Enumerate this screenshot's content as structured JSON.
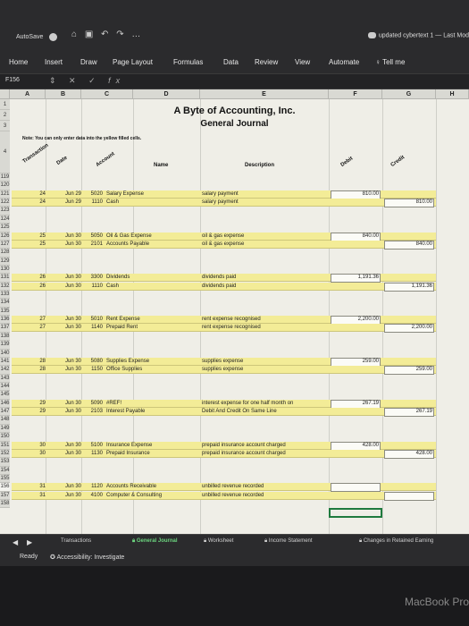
{
  "titlebar": {
    "autosave_label": "AutoSave",
    "doc_title": "updated cybertext 1 — Last Mod"
  },
  "ribbon": {
    "tabs": [
      "Home",
      "Insert",
      "Draw",
      "Page Layout",
      "Formulas",
      "Data",
      "Review",
      "View",
      "Automate"
    ],
    "tell_me": "Tell me"
  },
  "formula_bar": {
    "name_box": "F156",
    "fx": "fx"
  },
  "columns": [
    "A",
    "B",
    "C",
    "D",
    "E",
    "F",
    "G",
    "H"
  ],
  "sheet": {
    "row1": "1",
    "row2": "2",
    "row3": "3",
    "row4": "4",
    "title": "A Byte of Accounting, Inc.",
    "subtitle": "General Journal",
    "note": "Note: You can only enter data into the yellow filled cells.",
    "headers": {
      "transaction": "Transaction",
      "date": "Date",
      "account": "Account",
      "name": "Name",
      "description": "Description",
      "debit": "Debit",
      "credit": "Credit"
    },
    "rows": [
      {
        "n": "119",
        "t": "",
        "d": "",
        "a": "",
        "name": "",
        "desc": "",
        "dr": "",
        "cr": ""
      },
      {
        "n": "120",
        "t": "",
        "d": "",
        "a": "",
        "name": "",
        "desc": "",
        "dr": "",
        "cr": ""
      },
      {
        "n": "121",
        "t": "24",
        "d": "Jun 29",
        "a": "5020",
        "name": "Salary Expense",
        "desc": "salary payment",
        "dr": "810.00",
        "cr": ""
      },
      {
        "n": "122",
        "t": "24",
        "d": "Jun 29",
        "a": "1110",
        "name": "Cash",
        "desc": "salary payment",
        "dr": "",
        "cr": "810.00"
      },
      {
        "n": "123",
        "t": "",
        "d": "",
        "a": "",
        "name": "",
        "desc": "",
        "dr": "",
        "cr": ""
      },
      {
        "n": "124",
        "t": "",
        "d": "",
        "a": "",
        "name": "",
        "desc": "",
        "dr": "",
        "cr": ""
      },
      {
        "n": "125",
        "t": "",
        "d": "",
        "a": "",
        "name": "",
        "desc": "",
        "dr": "",
        "cr": ""
      },
      {
        "n": "126",
        "t": "25",
        "d": "Jun 30",
        "a": "5050",
        "name": "Oil & Gas Expense",
        "desc": "oil & gas expense",
        "dr": "840.00",
        "cr": ""
      },
      {
        "n": "127",
        "t": "25",
        "d": "Jun 30",
        "a": "2101",
        "name": "Accounts Payable",
        "desc": "oil & gas expense",
        "dr": "",
        "cr": "840.00"
      },
      {
        "n": "128",
        "t": "",
        "d": "",
        "a": "",
        "name": "",
        "desc": "",
        "dr": "",
        "cr": ""
      },
      {
        "n": "129",
        "t": "",
        "d": "",
        "a": "",
        "name": "",
        "desc": "",
        "dr": "",
        "cr": ""
      },
      {
        "n": "130",
        "t": "",
        "d": "",
        "a": "",
        "name": "",
        "desc": "",
        "dr": "",
        "cr": ""
      },
      {
        "n": "131",
        "t": "26",
        "d": "Jun 30",
        "a": "3300",
        "name": "Dividends",
        "desc": "dividends paid",
        "dr": "1,191.36",
        "cr": ""
      },
      {
        "n": "132",
        "t": "26",
        "d": "Jun 30",
        "a": "1110",
        "name": "Cash",
        "desc": "dividends paid",
        "dr": "",
        "cr": "1,191.36"
      },
      {
        "n": "133",
        "t": "",
        "d": "",
        "a": "",
        "name": "",
        "desc": "",
        "dr": "",
        "cr": ""
      },
      {
        "n": "134",
        "t": "",
        "d": "",
        "a": "",
        "name": "",
        "desc": "",
        "dr": "",
        "cr": ""
      },
      {
        "n": "135",
        "t": "",
        "d": "",
        "a": "",
        "name": "",
        "desc": "",
        "dr": "",
        "cr": ""
      },
      {
        "n": "136",
        "t": "27",
        "d": "Jun 30",
        "a": "5010",
        "name": "Rent Expense",
        "desc": "rent expense recognised",
        "dr": "2,200.00",
        "cr": ""
      },
      {
        "n": "137",
        "t": "27",
        "d": "Jun 30",
        "a": "1140",
        "name": "Prepaid Rent",
        "desc": "rent expense recognised",
        "dr": "",
        "cr": "2,200.00"
      },
      {
        "n": "138",
        "t": "",
        "d": "",
        "a": "",
        "name": "",
        "desc": "",
        "dr": "",
        "cr": ""
      },
      {
        "n": "139",
        "t": "",
        "d": "",
        "a": "",
        "name": "",
        "desc": "",
        "dr": "",
        "cr": ""
      },
      {
        "n": "140",
        "t": "",
        "d": "",
        "a": "",
        "name": "",
        "desc": "",
        "dr": "",
        "cr": ""
      },
      {
        "n": "141",
        "t": "28",
        "d": "Jun 30",
        "a": "5080",
        "name": "Supplies Expense",
        "desc": "supplies expense",
        "dr": "259.00",
        "cr": ""
      },
      {
        "n": "142",
        "t": "28",
        "d": "Jun 30",
        "a": "1150",
        "name": "Office Supplies",
        "desc": "supplies expense",
        "dr": "",
        "cr": "259.00"
      },
      {
        "n": "143",
        "t": "",
        "d": "",
        "a": "",
        "name": "",
        "desc": "",
        "dr": "",
        "cr": ""
      },
      {
        "n": "144",
        "t": "",
        "d": "",
        "a": "",
        "name": "",
        "desc": "",
        "dr": "",
        "cr": ""
      },
      {
        "n": "145",
        "t": "",
        "d": "",
        "a": "",
        "name": "",
        "desc": "",
        "dr": "",
        "cr": ""
      },
      {
        "n": "146",
        "t": "29",
        "d": "Jun 30",
        "a": "5090",
        "name": "#REF!",
        "desc": "interest expense for one half month on",
        "dr": "267.19",
        "cr": ""
      },
      {
        "n": "147",
        "t": "29",
        "d": "Jun 30",
        "a": "2103",
        "name": "Interest Payable",
        "desc": "Debit And Credit On Same Line",
        "dr": "",
        "cr": "267.19"
      },
      {
        "n": "148",
        "t": "",
        "d": "",
        "a": "",
        "name": "",
        "desc": "",
        "dr": "",
        "cr": ""
      },
      {
        "n": "149",
        "t": "",
        "d": "",
        "a": "",
        "name": "",
        "desc": "",
        "dr": "",
        "cr": ""
      },
      {
        "n": "150",
        "t": "",
        "d": "",
        "a": "",
        "name": "",
        "desc": "",
        "dr": "",
        "cr": ""
      },
      {
        "n": "151",
        "t": "30",
        "d": "Jun 30",
        "a": "5100",
        "name": "Insurance Expense",
        "desc": "prepaid insurance account charged",
        "dr": "428.00",
        "cr": ""
      },
      {
        "n": "152",
        "t": "30",
        "d": "Jun 30",
        "a": "1130",
        "name": "Prepaid Insurance",
        "desc": "prepaid insurance account charged",
        "dr": "",
        "cr": "428.00"
      },
      {
        "n": "153",
        "t": "",
        "d": "",
        "a": "",
        "name": "",
        "desc": "",
        "dr": "",
        "cr": ""
      },
      {
        "n": "154",
        "t": "",
        "d": "",
        "a": "",
        "name": "",
        "desc": "",
        "dr": "",
        "cr": ""
      },
      {
        "n": "155",
        "t": "",
        "d": "",
        "a": "",
        "name": "",
        "desc": "",
        "dr": "",
        "cr": ""
      },
      {
        "n": "156",
        "t": "31",
        "d": "Jun 30",
        "a": "1120",
        "name": "Accounts Receivable",
        "desc": "unbilled revenue recorded",
        "dr": "",
        "cr": ""
      },
      {
        "n": "157",
        "t": "31",
        "d": "Jun 30",
        "a": "4100",
        "name": "Computer & Consulting",
        "desc": "unbilled revenue recorded",
        "dr": "",
        "cr": ""
      },
      {
        "n": "158",
        "t": "",
        "d": "",
        "a": "",
        "name": "",
        "desc": "",
        "dr": "",
        "cr": ""
      }
    ]
  },
  "sheet_tabs": [
    "Transactions",
    "General Journal",
    "Worksheet",
    "Income Statement",
    "Changes in Retained Earning"
  ],
  "active_tab": "General Journal",
  "status": {
    "ready": "Ready",
    "accessibility": "Accessibility: Investigate"
  },
  "bezel_label": "MacBook Pro",
  "colors": {
    "yellow_fill": "#f3ec97",
    "active_tab": "#6bd37e",
    "selection": "#1f7a3e"
  }
}
